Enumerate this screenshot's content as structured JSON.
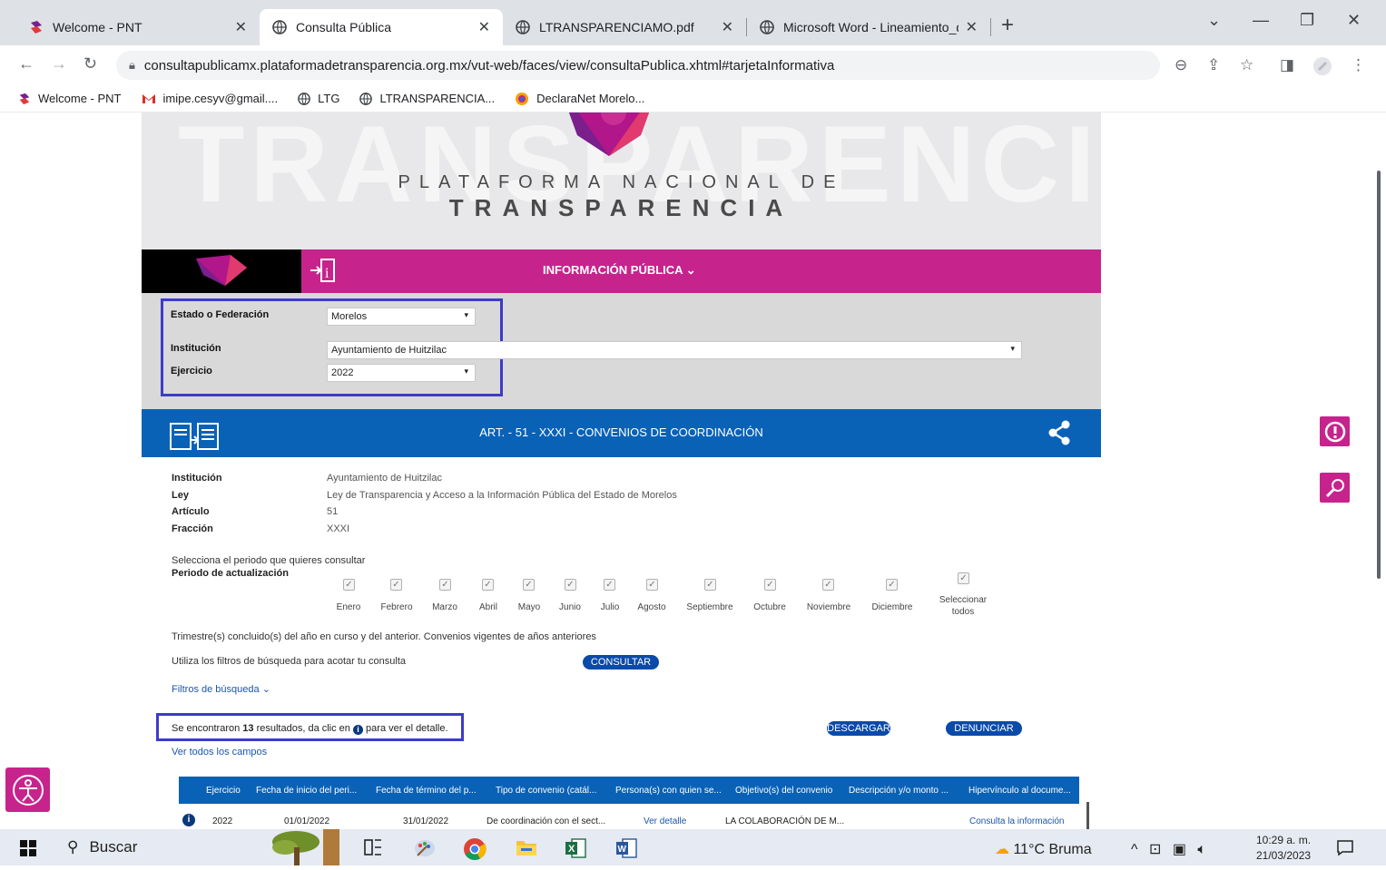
{
  "browser": {
    "tabs": [
      {
        "label": "Welcome - PNT",
        "active": false
      },
      {
        "label": "Consulta Pública",
        "active": true
      },
      {
        "label": "LTRANSPARENCIAMO.pdf",
        "active": false
      },
      {
        "label": "Microsoft Word - Lineamiento_de",
        "active": false
      }
    ],
    "url": "consultapublicamx.plataformadetransparencia.org.mx/vut-web/faces/view/consultaPublica.xhtml#tarjetaInformativa",
    "bookmarks": [
      "Welcome - PNT",
      "imipe.cesyv@gmail....",
      "LTG",
      "LTRANSPARENCIA...",
      "DeclaraNet Morelo..."
    ]
  },
  "header": {
    "line1": "PLATAFORMA NACIONAL DE",
    "line2": "TRANSPARENCIA",
    "menu": "INFORMACIÓN PÚBLICA"
  },
  "filters": {
    "estado_label": "Estado o Federación",
    "estado_value": "Morelos",
    "institucion_label": "Institución",
    "institucion_value": "Ayuntamiento de Huitzilac",
    "ejercicio_label": "Ejercicio",
    "ejercicio_value": "2022"
  },
  "section": {
    "title": "ART. - 51 - XXXI - CONVENIOS DE COORDINACIÓN"
  },
  "meta": {
    "institucion_label": "Institución",
    "institucion_value": "Ayuntamiento de Huitzilac",
    "ley_label": "Ley",
    "ley_value": "Ley de Transparencia y Acceso a la Información Pública del Estado de Morelos",
    "articulo_label": "Artículo",
    "articulo_value": "51",
    "fraccion_label": "Fracción",
    "fraccion_value": "XXXI"
  },
  "periodo": {
    "prompt": "Selecciona el periodo que quieres consultar",
    "label": "Periodo de actualización",
    "months": [
      "Enero",
      "Febrero",
      "Marzo",
      "Abril",
      "Mayo",
      "Junio",
      "Julio",
      "Agosto",
      "Septiembre",
      "Octubre",
      "Noviembre",
      "Diciembre"
    ],
    "select_all_1": "Seleccionar",
    "select_all_2": "todos",
    "note": "Trimestre(s) concluido(s) del año en curso y del anterior. Convenios vigentes de años anteriores"
  },
  "search": {
    "hint": "Utiliza los filtros de búsqueda para acotar tu consulta",
    "consult_button": "CONSULTAR",
    "filters_link": "Filtros de búsqueda"
  },
  "results": {
    "prefix": "Se encontraron ",
    "count": "13",
    "suffix": " resultados, da clic en ",
    "suffix2": " para ver el detalle.",
    "download_button": "DESCARGAR",
    "report_button": "DENUNCIAR",
    "all_fields_link": "Ver todos los campos"
  },
  "table": {
    "headers": [
      "Ejercicio",
      "Fecha de inicio del peri...",
      "Fecha de término del p...",
      "Tipo de convenio (catál...",
      "Persona(s) con quien se...",
      "Objetivo(s) del convenio",
      "Descripción y/o monto ...",
      "Hipervínculo al docume..."
    ],
    "row": [
      "2022",
      "01/01/2022",
      "31/01/2022",
      "De coordinación con el sect...",
      "Ver detalle",
      "LA COLABORACIÓN DE M...",
      "",
      "Consulta la información"
    ]
  },
  "taskbar": {
    "search": "Buscar",
    "weather": "11°C  Bruma",
    "time": "10:29 a. m.",
    "date": "21/03/2023"
  }
}
